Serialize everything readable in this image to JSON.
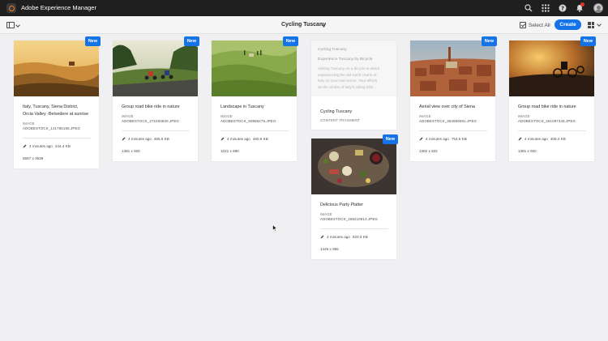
{
  "app": {
    "title": "Adobe Experience Manager"
  },
  "toolbar": {
    "folder_title": "Cycling Tuscany",
    "select_all_label": "Select All",
    "create_label": "Create"
  },
  "icons": {
    "brand": "adobe-experience-manager-logo",
    "search": "search-icon",
    "apps": "apps-grid-icon",
    "help": "help-icon",
    "notifications": "bell-icon",
    "user": "avatar",
    "rail": "side-rail-toggle-icon",
    "select_all": "checkbox-icon",
    "view": "card-view-icon"
  },
  "colors": {
    "accent": "#1473e6",
    "topbar": "#1f1f1f",
    "badge": "#1473e6",
    "notification": "#e0352b"
  },
  "cards": [
    {
      "badge": "New",
      "title_lines": [
        "Italy, Tuscany, Siena District,",
        "Orcia Valley -Belvedere at sunrise"
      ],
      "type": "IMAGE",
      "file": "ADOBESTOCK_141786186.JPEG",
      "modified": "4 minutes ago",
      "size": "244.4 KB",
      "dimensions": "5557 x 3539"
    },
    {
      "badge": "New",
      "title_lines": [
        "Group road bike ride in nature"
      ],
      "type": "IMAGE",
      "file": "ADOBESTOCK_272493830.JPEG",
      "modified": "4 minutes ago",
      "size": "485.9 KB",
      "dimensions": "1381 x 920"
    },
    {
      "badge": "New",
      "title_lines": [
        "Landscape in Tuscany"
      ],
      "type": "IMAGE",
      "file": "ADOBESTOCK_60986275.JPEG",
      "modified": "4 minutes ago",
      "size": "460.6 KB",
      "dimensions": "1021 x 680"
    },
    {
      "fragment_preview": {
        "line1": "Cycling Tuscany",
        "line2": "Experience Tuscany by Bicycle",
        "body": [
          "Visiting Tuscany on a bicycle is about",
          "experiencing the old world charm of",
          "Italy on your own terms. Your efforts",
          "on the climbs of Italy's rolling hills..."
        ]
      },
      "title_lines": [
        "Cycling Tuscany"
      ],
      "type": "CONTENT FRAGMENT"
    },
    {
      "badge": "New",
      "title_lines": [
        "Delicious Party Platter"
      ],
      "type": "IMAGE",
      "file": "ADOBESTOCK_268210814.JPEG",
      "modified": "4 minutes ago",
      "size": "620.3 KB",
      "dimensions": "1446 x 965"
    },
    {
      "badge": "New",
      "title_lines": [
        "Aerial view over city of Siena"
      ],
      "type": "IMAGE",
      "file": "ADOBESTOCK_364959081.JPEG",
      "modified": "4 minutes ago",
      "size": "754.5 KB",
      "dimensions": "1382 x 922"
    },
    {
      "badge": "New",
      "title_lines": [
        "Group road bike ride in nature"
      ],
      "type": "IMAGE",
      "file": "ADOBESTOCK_261097345.JPEG",
      "modified": "4 minutes ago",
      "size": "408.4 KB",
      "dimensions": "1381 x 920"
    }
  ]
}
